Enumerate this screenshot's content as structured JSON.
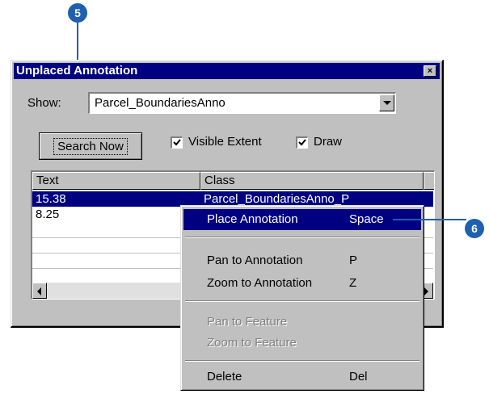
{
  "callouts": {
    "first": "5",
    "second": "6"
  },
  "window": {
    "title": "Unplaced Annotation",
    "close_glyph": "×"
  },
  "show": {
    "label": "Show:",
    "value": "Parcel_BoundariesAnno"
  },
  "search_button": {
    "label": "Search Now"
  },
  "checkboxes": [
    {
      "label": "Visible Extent",
      "checked": true
    },
    {
      "label": "Draw",
      "checked": true
    }
  ],
  "list": {
    "columns": [
      "Text",
      "Class"
    ],
    "rows": [
      {
        "text": "15.38",
        "class": "Parcel_BoundariesAnno_P",
        "selected": true
      },
      {
        "text": "8.25",
        "class": "",
        "selected": false
      }
    ]
  },
  "context_menu": {
    "items": [
      {
        "label": "Place Annotation",
        "shortcut": "Space",
        "highlighted": true,
        "enabled": true
      },
      {
        "label": "Pan to Annotation",
        "shortcut": "P",
        "enabled": true
      },
      {
        "label": "Zoom to Annotation",
        "shortcut": "Z",
        "enabled": true
      },
      {
        "label": "Pan to Feature",
        "shortcut": "",
        "enabled": false
      },
      {
        "label": "Zoom to Feature",
        "shortcut": "",
        "enabled": false
      },
      {
        "label": "Delete",
        "shortcut": "Del",
        "enabled": true
      }
    ]
  },
  "colors": {
    "callout": "#1f5fb0",
    "titlebar": "#000080",
    "selection": "#000080",
    "face": "#c0c0c0"
  }
}
